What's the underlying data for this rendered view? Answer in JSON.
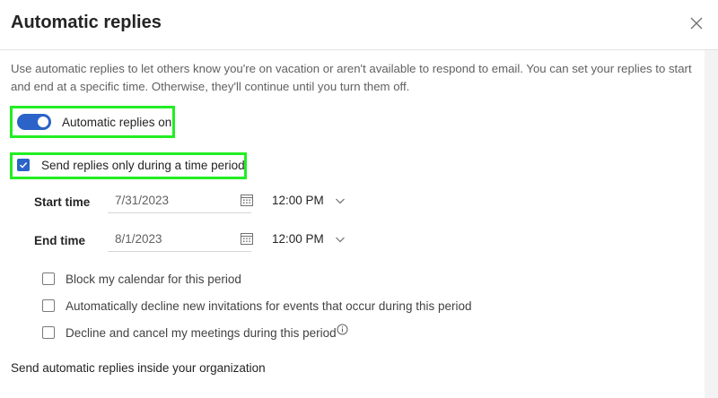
{
  "dialog": {
    "title": "Automatic replies",
    "description": "Use automatic replies to let others know you're on vacation or aren't available to respond to email. You can set your replies to start and end at a specific time. Otherwise, they'll continue until you turn them off."
  },
  "toggle": {
    "label": "Automatic replies on",
    "on": true
  },
  "time_period": {
    "label": "Send replies only during a time period",
    "checked": true
  },
  "start": {
    "label": "Start time",
    "date": "7/31/2023",
    "time": "12:00 PM"
  },
  "end": {
    "label": "End time",
    "date": "8/1/2023",
    "time": "12:00 PM"
  },
  "options": [
    {
      "label": "Block my calendar for this period",
      "checked": false
    },
    {
      "label": "Automatically decline new invitations for events that occur during this period",
      "checked": false
    },
    {
      "label": "Decline and cancel my meetings during this period",
      "checked": false
    }
  ],
  "section": {
    "inside_org_label": "Send automatic replies inside your organization"
  },
  "colors": {
    "accent": "#2b63c8",
    "highlight": "#22ee22"
  },
  "icons": [
    "close-icon",
    "calendar-icon",
    "chevron-down-icon",
    "info-icon",
    "checkmark-icon"
  ]
}
